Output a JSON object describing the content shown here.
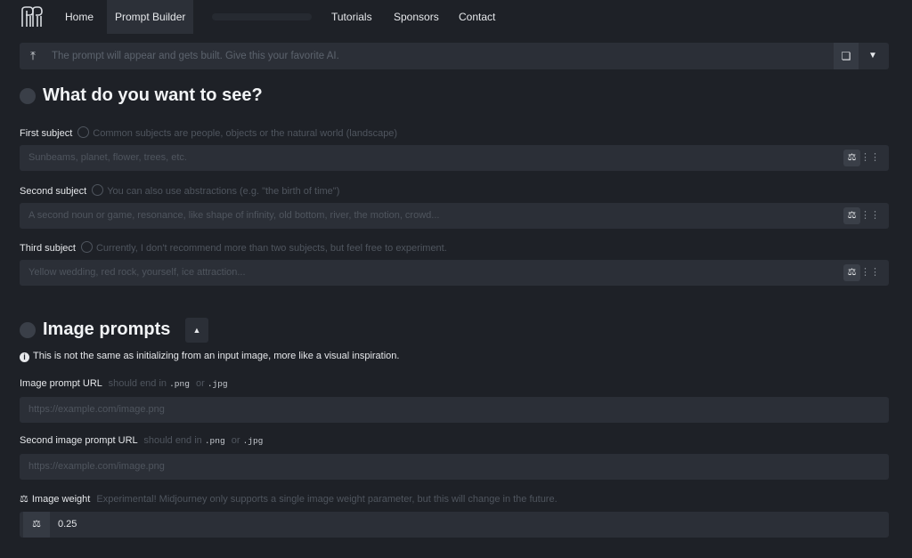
{
  "nav": {
    "items": [
      {
        "label": "Home"
      },
      {
        "label": "Prompt Builder",
        "active": true
      },
      {
        "label": "Tutorials"
      },
      {
        "label": "Sponsors"
      },
      {
        "label": "Contact"
      }
    ]
  },
  "prompt_bar": {
    "placeholder": "The prompt will appear and gets built. Give this your favorite AI."
  },
  "section_see": {
    "title": "What do you want to see?",
    "fields": [
      {
        "label": "First subject",
        "hint": "Common subjects are people, objects or the natural world (landscape)",
        "placeholder": "Sunbeams, planet, flower, trees, etc."
      },
      {
        "label": "Second subject",
        "hint": "You can also use abstractions (e.g. \"the birth of time\")",
        "placeholder": "A second noun or game, resonance, like shape of infinity, old bottom, river, the motion, crowd..."
      },
      {
        "label": "Third subject",
        "hint": "Currently, I don't recommend more than two subjects, but feel free to experiment.",
        "placeholder": "Yellow wedding, red rock, yourself, ice attraction..."
      }
    ]
  },
  "section_images": {
    "title": "Image prompts",
    "info": "This is not the same as initializing from an input image, more like a visual inspiration.",
    "url1_label": "Image prompt URL",
    "url1_hint": "should end in",
    "url1_ext1": ".png",
    "url1_or": "or",
    "url1_ext2": ".jpg",
    "url1_placeholder": "https://example.com/image.png",
    "url2_label": "Second image prompt URL",
    "url2_hint": "should end in",
    "url2_ext1": ".png",
    "url2_or": "or",
    "url2_ext2": ".jpg",
    "url2_placeholder": "https://example.com/image.png",
    "weight_label": "Image weight",
    "weight_hint": "Experimental! Midjourney only supports a single image weight parameter, but this will change in the future.",
    "weight_value": "0.25"
  },
  "colors": {
    "background": "#1e2127",
    "field": "#2b2f37",
    "text": "#e6e8eb",
    "muted": "#4f555e"
  }
}
